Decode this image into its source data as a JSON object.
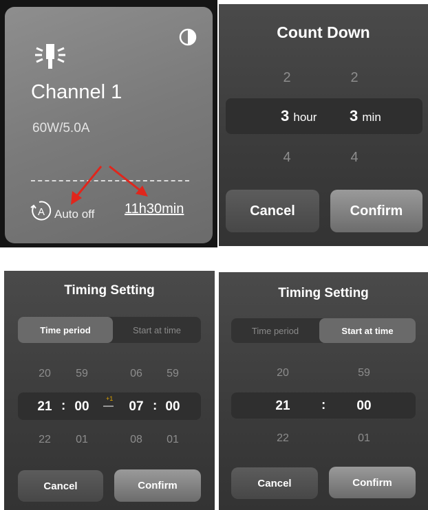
{
  "card": {
    "channel_name": "Channel 1",
    "power_spec": "60W/5.0A",
    "auto_off_label": "Auto off",
    "timer_value": "11h30min",
    "auto_icon_letter": "A"
  },
  "countdown": {
    "title": "Count Down",
    "hour_prev": "2",
    "hour_selected": "3",
    "hour_unit": "hour",
    "hour_next": "4",
    "min_prev": "2",
    "min_selected": "3",
    "min_unit": "min",
    "min_next": "4",
    "cancel_label": "Cancel",
    "confirm_label": "Confirm"
  },
  "timing_period": {
    "title": "Timing Setting",
    "tab_time_period": "Time period",
    "tab_start_at_time": "Start at time",
    "prev": [
      "20",
      "59",
      "06",
      "59"
    ],
    "selected": [
      "21",
      "00",
      "07",
      "00"
    ],
    "next": [
      "22",
      "01",
      "08",
      "01"
    ],
    "separator": ":",
    "next_day_badge": "+1",
    "range_dash": "—",
    "cancel_label": "Cancel",
    "confirm_label": "Confirm"
  },
  "timing_start": {
    "title": "Timing Setting",
    "tab_time_period": "Time period",
    "tab_start_at_time": "Start at time",
    "hour_prev": "20",
    "hour_selected": "21",
    "hour_next": "22",
    "min_prev": "59",
    "min_selected": "00",
    "min_next": "01",
    "separator": ":",
    "cancel_label": "Cancel",
    "confirm_label": "Confirm"
  },
  "colors": {
    "panel_dark": "#3b3b3b",
    "annotation_arrow": "#e0261c",
    "next_day_badge": "#e0a400"
  }
}
